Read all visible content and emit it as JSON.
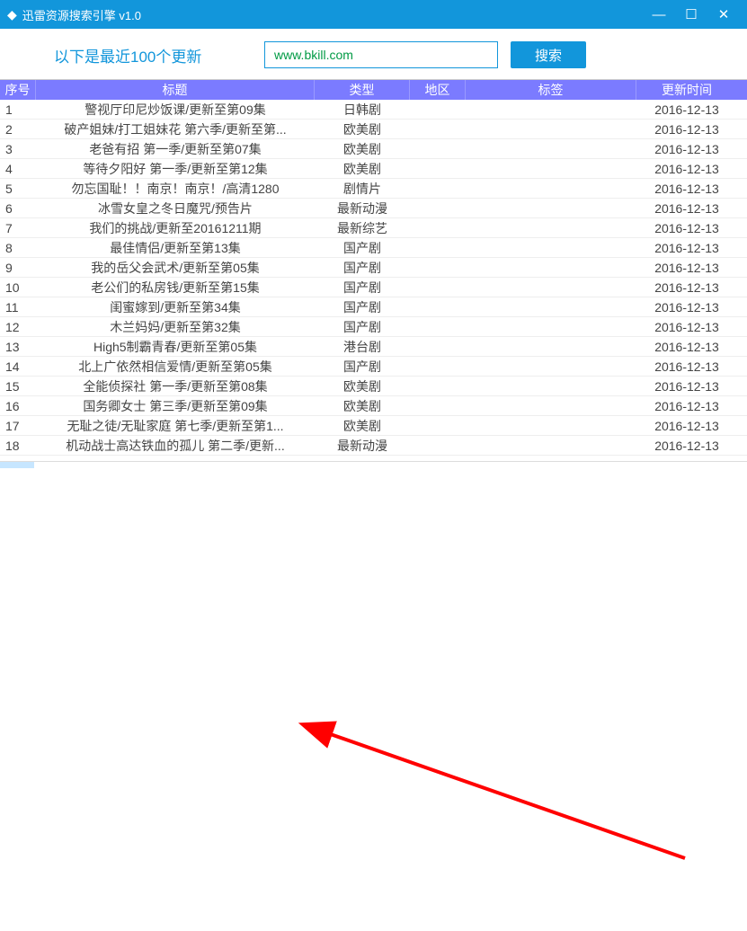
{
  "window": {
    "title": "迅雷资源搜索引擎 v1.0"
  },
  "toolbar": {
    "update_label": "以下是最近100个更新",
    "search_value": "www.bkill.com",
    "search_btn": "搜索"
  },
  "columns": {
    "idx": "序号",
    "title": "标题",
    "type": "类型",
    "region": "地区",
    "tag": "标签",
    "time": "更新时间"
  },
  "rows": [
    {
      "idx": "1",
      "title": "警视厅印尼炒饭课/更新至第09集",
      "type": "日韩剧",
      "time": "2016-12-13"
    },
    {
      "idx": "2",
      "title": "破产姐妹/打工姐妹花 第六季/更新至第...",
      "type": "欧美剧",
      "time": "2016-12-13"
    },
    {
      "idx": "3",
      "title": "老爸有招 第一季/更新至第07集",
      "type": "欧美剧",
      "time": "2016-12-13"
    },
    {
      "idx": "4",
      "title": "等待夕阳好 第一季/更新至第12集",
      "type": "欧美剧",
      "time": "2016-12-13"
    },
    {
      "idx": "5",
      "title": "勿忘国耻！！南京！南京！/高清1280",
      "type": "剧情片",
      "time": "2016-12-13"
    },
    {
      "idx": "6",
      "title": "冰雪女皇之冬日魔咒/预告片",
      "type": "最新动漫",
      "time": "2016-12-13"
    },
    {
      "idx": "7",
      "title": "我们的挑战/更新至20161211期",
      "type": "最新综艺",
      "time": "2016-12-13"
    },
    {
      "idx": "8",
      "title": "最佳情侣/更新至第13集",
      "type": "国产剧",
      "time": "2016-12-13"
    },
    {
      "idx": "9",
      "title": "我的岳父会武术/更新至第05集",
      "type": "国产剧",
      "time": "2016-12-13"
    },
    {
      "idx": "10",
      "title": "老公们的私房钱/更新至第15集",
      "type": "国产剧",
      "time": "2016-12-13"
    },
    {
      "idx": "11",
      "title": "闺蜜嫁到/更新至第34集",
      "type": "国产剧",
      "time": "2016-12-13"
    },
    {
      "idx": "12",
      "title": "木兰妈妈/更新至第32集",
      "type": "国产剧",
      "time": "2016-12-13"
    },
    {
      "idx": "13",
      "title": "High5制霸青春/更新至第05集",
      "type": "港台剧",
      "time": "2016-12-13"
    },
    {
      "idx": "14",
      "title": "北上广依然相信爱情/更新至第05集",
      "type": "国产剧",
      "time": "2016-12-13"
    },
    {
      "idx": "15",
      "title": "全能侦探社 第一季/更新至第08集",
      "type": "欧美剧",
      "time": "2016-12-13"
    },
    {
      "idx": "16",
      "title": "国务卿女士 第三季/更新至第09集",
      "type": "欧美剧",
      "time": "2016-12-13"
    },
    {
      "idx": "17",
      "title": "无耻之徒/无耻家庭 第七季/更新至第1...",
      "type": "欧美剧",
      "time": "2016-12-13"
    },
    {
      "idx": "18",
      "title": "机动战士高达铁血的孤儿 第二季/更新...",
      "type": "最新动漫",
      "time": "2016-12-13"
    }
  ]
}
